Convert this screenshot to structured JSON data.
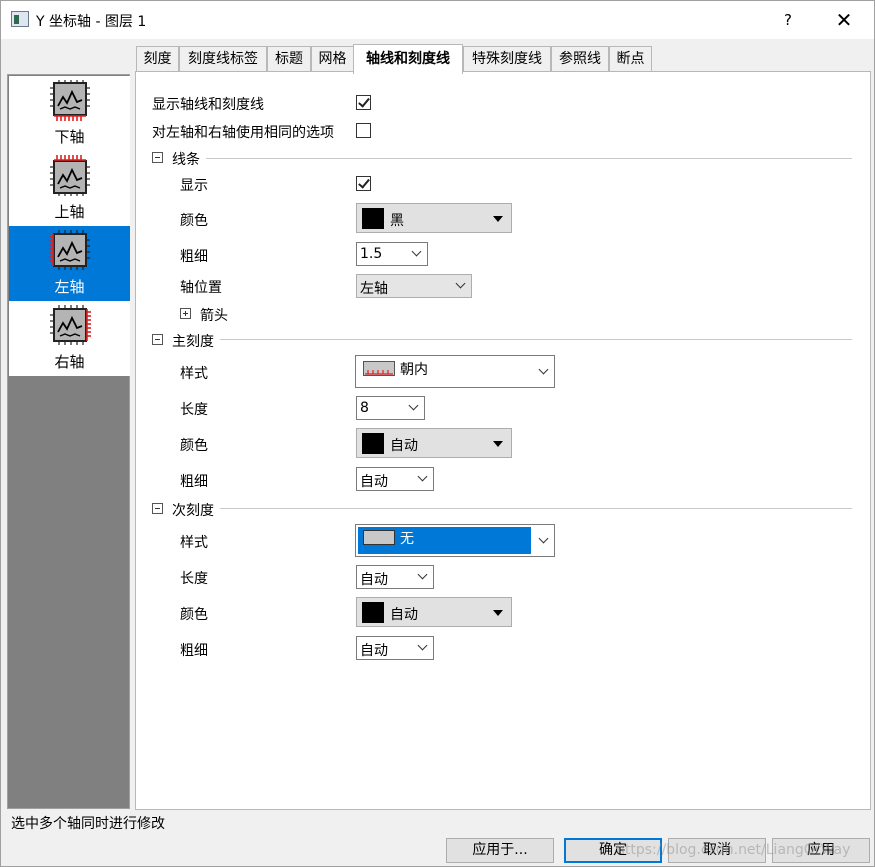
{
  "window": {
    "title": "Y 坐标轴 - 图层 1",
    "help_label": "?",
    "close_label": "✕"
  },
  "axis_list": [
    {
      "label": "下轴",
      "icon": "bottom-axis-icon",
      "selected": false
    },
    {
      "label": "上轴",
      "icon": "top-axis-icon",
      "selected": false
    },
    {
      "label": "左轴",
      "icon": "left-axis-icon",
      "selected": true
    },
    {
      "label": "右轴",
      "icon": "right-axis-icon",
      "selected": false
    }
  ],
  "tabs": [
    {
      "label": "刻度",
      "active": false
    },
    {
      "label": "刻度线标签",
      "active": false
    },
    {
      "label": "标题",
      "active": false
    },
    {
      "label": "网格",
      "active": false
    },
    {
      "label": "轴线和刻度线",
      "active": true
    },
    {
      "label": "特殊刻度线",
      "active": false
    },
    {
      "label": "参照线",
      "active": false
    },
    {
      "label": "断点",
      "active": false
    }
  ],
  "options": {
    "show_axes_ticks": {
      "label": "显示轴线和刻度线",
      "checked": true
    },
    "same_options": {
      "label": "对左轴和右轴使用相同的选项",
      "checked": false
    }
  },
  "line_section": {
    "title": "线条",
    "show": {
      "label": "显示",
      "checked": true
    },
    "color": {
      "label": "颜色",
      "value": "黑",
      "swatch": "#000000"
    },
    "thickness": {
      "label": "粗细",
      "value": "1.5"
    },
    "axis_position": {
      "label": "轴位置",
      "value": "左轴"
    },
    "arrow": {
      "label": "箭头"
    }
  },
  "major_ticks": {
    "title": "主刻度",
    "style": {
      "label": "样式",
      "value": "朝内"
    },
    "length": {
      "label": "长度",
      "value": "8"
    },
    "color": {
      "label": "颜色",
      "value": "自动",
      "swatch": "#000000"
    },
    "thickness": {
      "label": "粗细",
      "value": "自动"
    }
  },
  "minor_ticks": {
    "title": "次刻度",
    "style": {
      "label": "样式",
      "value": "无"
    },
    "length": {
      "label": "长度",
      "value": "自动"
    },
    "color": {
      "label": "颜色",
      "value": "自动",
      "swatch": "#000000"
    },
    "thickness": {
      "label": "粗细",
      "value": "自动"
    }
  },
  "status": {
    "text": "选中多个轴同时进行修改"
  },
  "buttons": {
    "apply_to": "应用于...",
    "ok": "确定",
    "cancel": "取消",
    "apply": "应用"
  },
  "watermark": "https://blog.csdn.net/LiangOrWay",
  "colors": {
    "selection": "#0078d7",
    "tick_red": "#e02020"
  }
}
